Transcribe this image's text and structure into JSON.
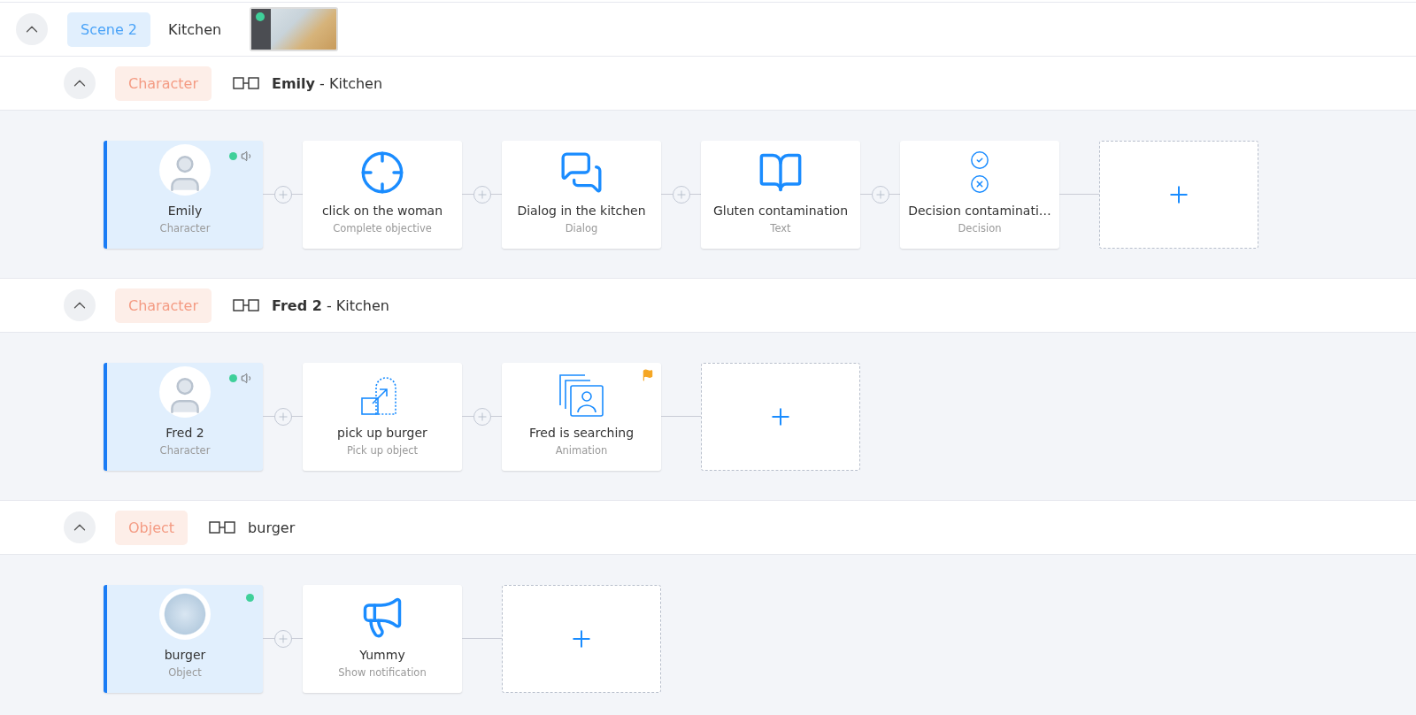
{
  "scene": {
    "badge": "Scene 2",
    "name": "Kitchen",
    "expanded": true
  },
  "groups": [
    {
      "badge": "Character",
      "title": "**Emily** - Kitchen",
      "expanded": true,
      "steps": [
        {
          "kind": "character",
          "title": "Emily",
          "subtitle": "Character",
          "online": true,
          "sound": true
        },
        {
          "kind": "objective",
          "title": "click on the woman",
          "subtitle": "Complete objective"
        },
        {
          "kind": "dialog",
          "title": "Dialog in the kitchen",
          "subtitle": "Dialog"
        },
        {
          "kind": "text",
          "title": "Gluten contamination",
          "subtitle": "Text"
        },
        {
          "kind": "decision",
          "title": "Decision contaminati…",
          "subtitle": "Decision"
        },
        {
          "kind": "add"
        }
      ]
    },
    {
      "badge": "Character",
      "title": "**Fred 2** - Kitchen",
      "expanded": true,
      "steps": [
        {
          "kind": "character",
          "title": "Fred 2",
          "subtitle": "Character",
          "online": true,
          "sound": true
        },
        {
          "kind": "pickup",
          "title": "pick up burger",
          "subtitle": "Pick up object"
        },
        {
          "kind": "animation",
          "title": "Fred is searching",
          "subtitle": "Animation",
          "flagged": true
        },
        {
          "kind": "add"
        }
      ]
    },
    {
      "badge": "Object",
      "title": "burger",
      "expanded": true,
      "steps": [
        {
          "kind": "object",
          "title": "burger",
          "subtitle": "Object",
          "online": true,
          "sound": false
        },
        {
          "kind": "notification",
          "title": "Yummy",
          "subtitle": "Show notification"
        },
        {
          "kind": "add"
        }
      ]
    }
  ]
}
